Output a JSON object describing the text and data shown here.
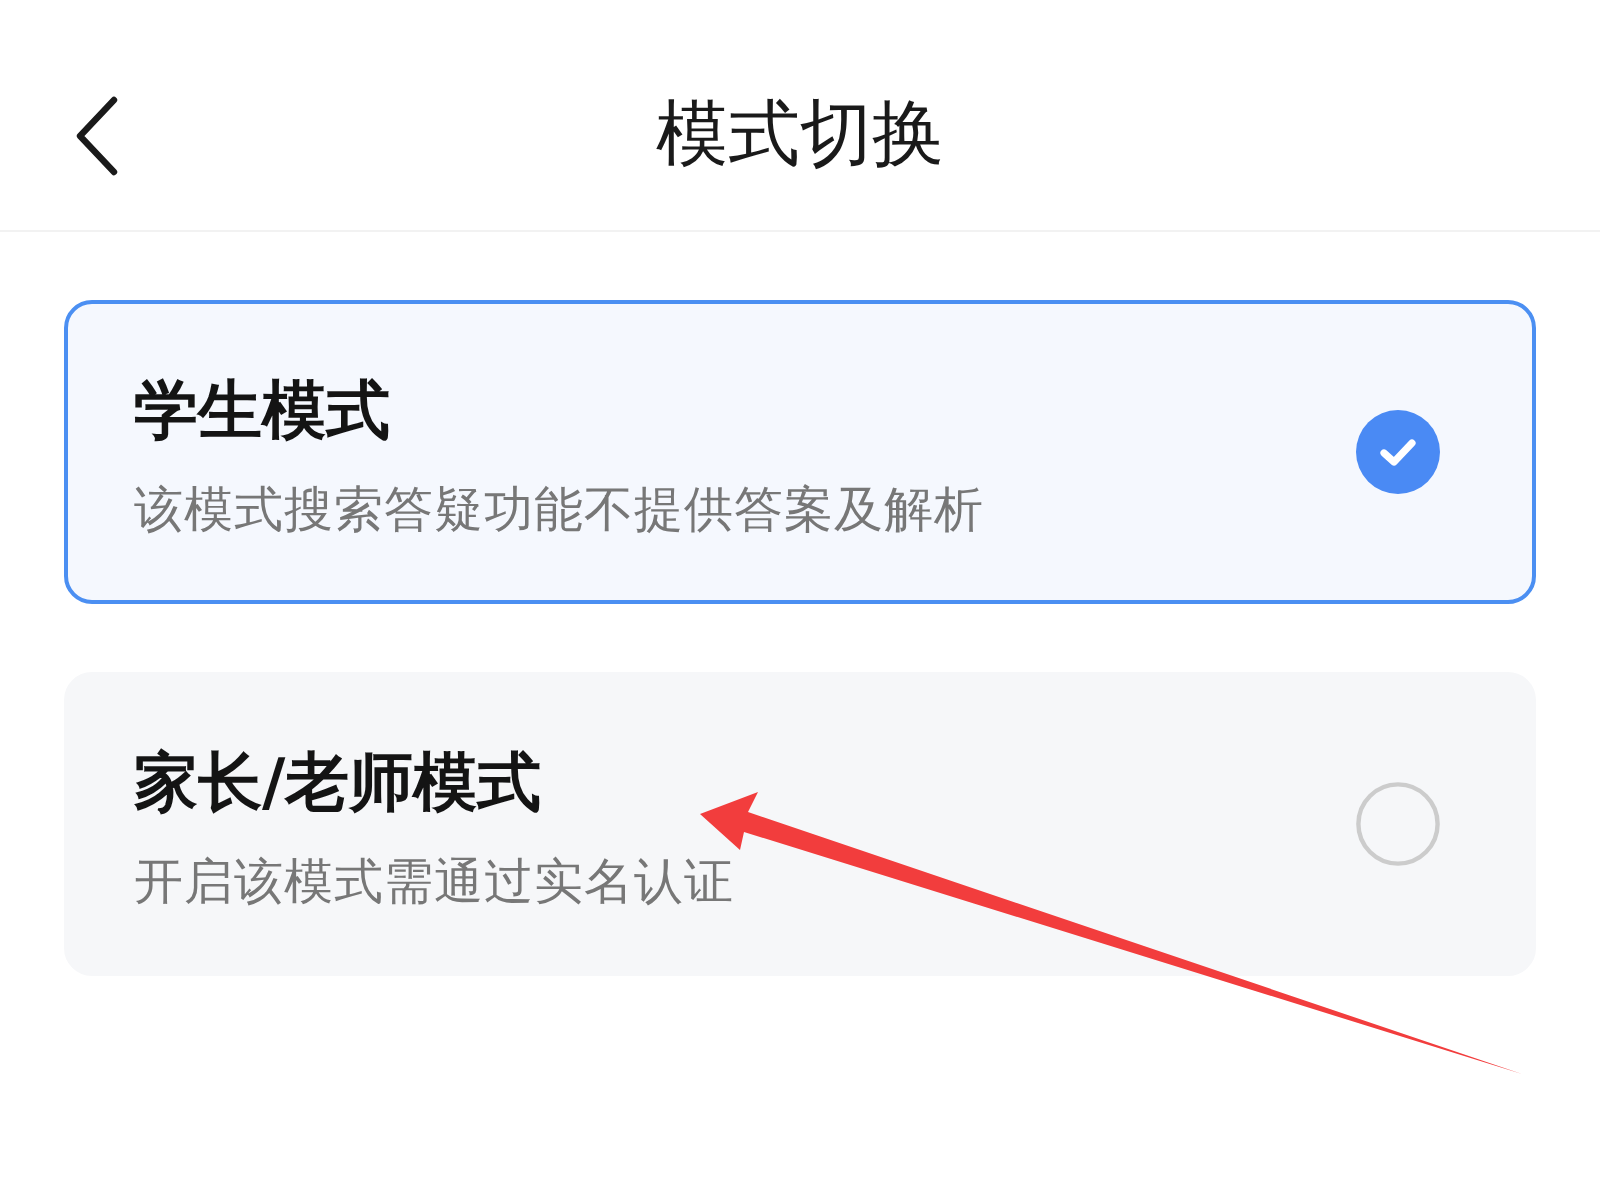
{
  "header": {
    "title": "模式切换"
  },
  "modes": [
    {
      "title": "学生模式",
      "description": "该模式搜索答疑功能不提供答案及解析",
      "selected": true
    },
    {
      "title": "家长/老师模式",
      "description": "开启该模式需通过实名认证",
      "selected": false
    }
  ]
}
